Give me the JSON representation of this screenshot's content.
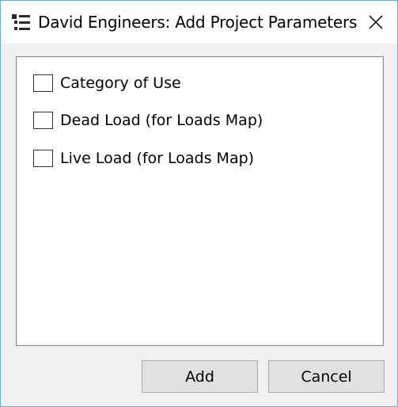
{
  "window": {
    "title": "David Engineers: Add Project Parameters",
    "icon": "list-icon",
    "close_icon": "close-icon"
  },
  "parameters": [
    {
      "label": "Category of Use",
      "checked": false
    },
    {
      "label": "Dead Load (for Loads Map)",
      "checked": false
    },
    {
      "label": "Live Load (for Loads Map)",
      "checked": false
    }
  ],
  "buttons": {
    "add_label": "Add",
    "cancel_label": "Cancel"
  }
}
